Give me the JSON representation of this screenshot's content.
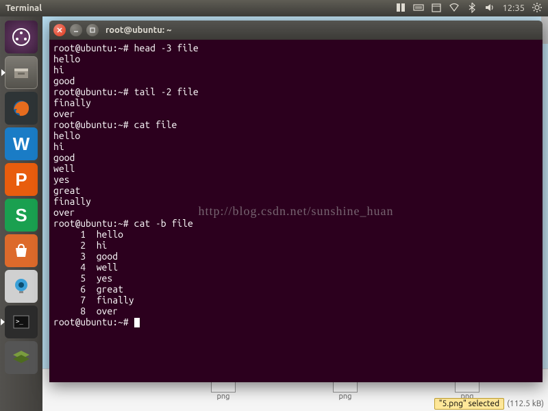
{
  "menubar": {
    "title": "Terminal",
    "clock": "12:35"
  },
  "launcher": {
    "items": [
      {
        "name": "dash",
        "letter": ""
      },
      {
        "name": "files",
        "letter": ""
      },
      {
        "name": "firefox",
        "letter": ""
      },
      {
        "name": "writer",
        "letter": "W"
      },
      {
        "name": "impress",
        "letter": "P"
      },
      {
        "name": "calc",
        "letter": "S"
      },
      {
        "name": "store",
        "letter": ""
      },
      {
        "name": "webcam",
        "letter": ""
      },
      {
        "name": "terminal",
        "letter": ""
      },
      {
        "name": "stack",
        "letter": ""
      }
    ]
  },
  "window": {
    "title": "root@ubuntu: ~"
  },
  "terminal": {
    "prompt": "root@ubuntu:~#",
    "sessions": [
      {
        "cmd": "head -3 file",
        "out": [
          "hello",
          "hi",
          "good"
        ]
      },
      {
        "cmd": "tail -2 file",
        "out": [
          "finally",
          "over"
        ]
      },
      {
        "cmd": "cat file",
        "out": [
          "hello",
          "hi",
          "good",
          "well",
          "yes",
          "great",
          "finally",
          "over"
        ]
      },
      {
        "cmd": "cat -b file",
        "out": [
          "     1  hello",
          "     2  hi",
          "     3  good",
          "     4  well",
          "     5  yes",
          "     6  great",
          "     7  finally",
          "     8  over"
        ]
      }
    ],
    "final_prompt": "root@ubuntu:~# "
  },
  "watermark": "http://blog.csdn.net/sunshine_huan",
  "filemanager": {
    "thumb_label": "png",
    "selected": "\"5.png\" selected",
    "size": "(112.5 kB)"
  }
}
